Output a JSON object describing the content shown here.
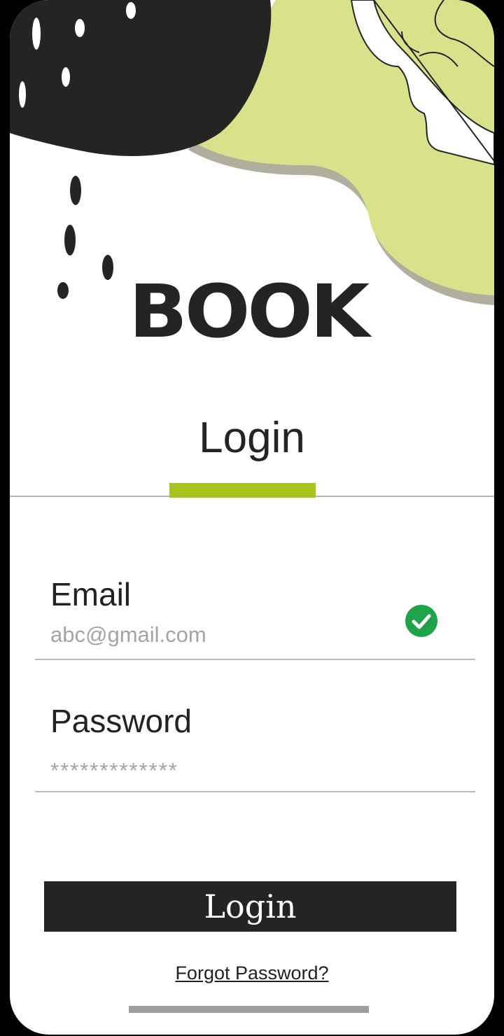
{
  "app": {
    "logo_text": "BOOK"
  },
  "header": {
    "title": "Login"
  },
  "form": {
    "email": {
      "label": "Email",
      "value": "abc@gmail.com",
      "valid": true
    },
    "password": {
      "label": "Password",
      "value": "*************"
    }
  },
  "actions": {
    "login_label": "Login",
    "forgot_label": "Forgot Password?"
  },
  "colors": {
    "accent": "#a8c41f",
    "lime": "#d8e28a",
    "dark": "#252422",
    "valid_green": "#1fa34a"
  }
}
